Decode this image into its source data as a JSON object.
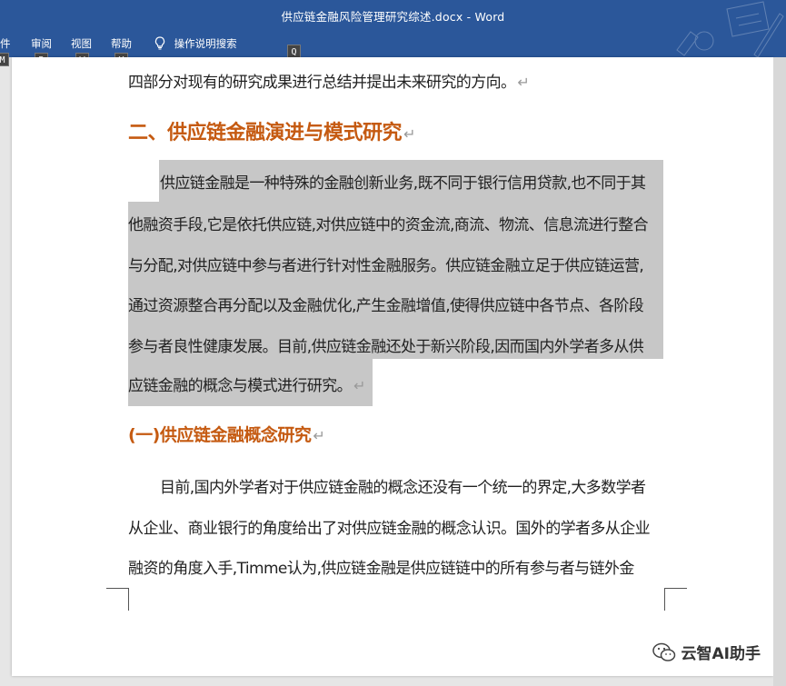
{
  "window": {
    "title": "供应链金融风险管理研究综述.docx  -  Word"
  },
  "ribbon": {
    "menu": [
      {
        "label": "件",
        "key": "M"
      },
      {
        "label": "审阅",
        "key": "R"
      },
      {
        "label": "视图",
        "key": "W"
      },
      {
        "label": "帮助",
        "key": "Y"
      }
    ],
    "tell_me": "操作说明搜索",
    "tell_me_key": "Q"
  },
  "document": {
    "line0": "四部分对现有的研究成果进行总结并提出未来研究的方向。",
    "heading2": "二、供应链金融演进与模式研究",
    "para1": [
      "供应链金融是一种特殊的金融创新业务,既不同于银行信用贷款,也不同于其",
      "他融资手段,它是依托供应链,对供应链中的资金流,商流、物流、信息流进行整合",
      "与分配,对供应链中参与者进行针对性金融服务。供应链金融立足于供应链运营,",
      "通过资源整合再分配以及金融优化,产生金融增值,使得供应链中各节点、各阶段",
      "参与者良性健康发展。目前,供应链金融还处于新兴阶段,因而国内外学者多从供",
      "应链金融的概念与模式进行研究。"
    ],
    "heading3": "(一)供应链金融概念研究",
    "para2": [
      "目前,国内外学者对于供应链金融的概念还没有一个统一的界定,大多数学者",
      "从企业、商业银行的角度给出了对供应链金融的概念认识。国外的学者多从企业",
      "融资的角度入手,Timme认为,供应链金融是供应链链中的所有参与者与链外金"
    ],
    "para_mark": "↵"
  },
  "watermark": "云智AI助手",
  "colors": {
    "ribbon": "#2b579a",
    "heading": "#c55a11",
    "selection": "#c7c7c7"
  }
}
